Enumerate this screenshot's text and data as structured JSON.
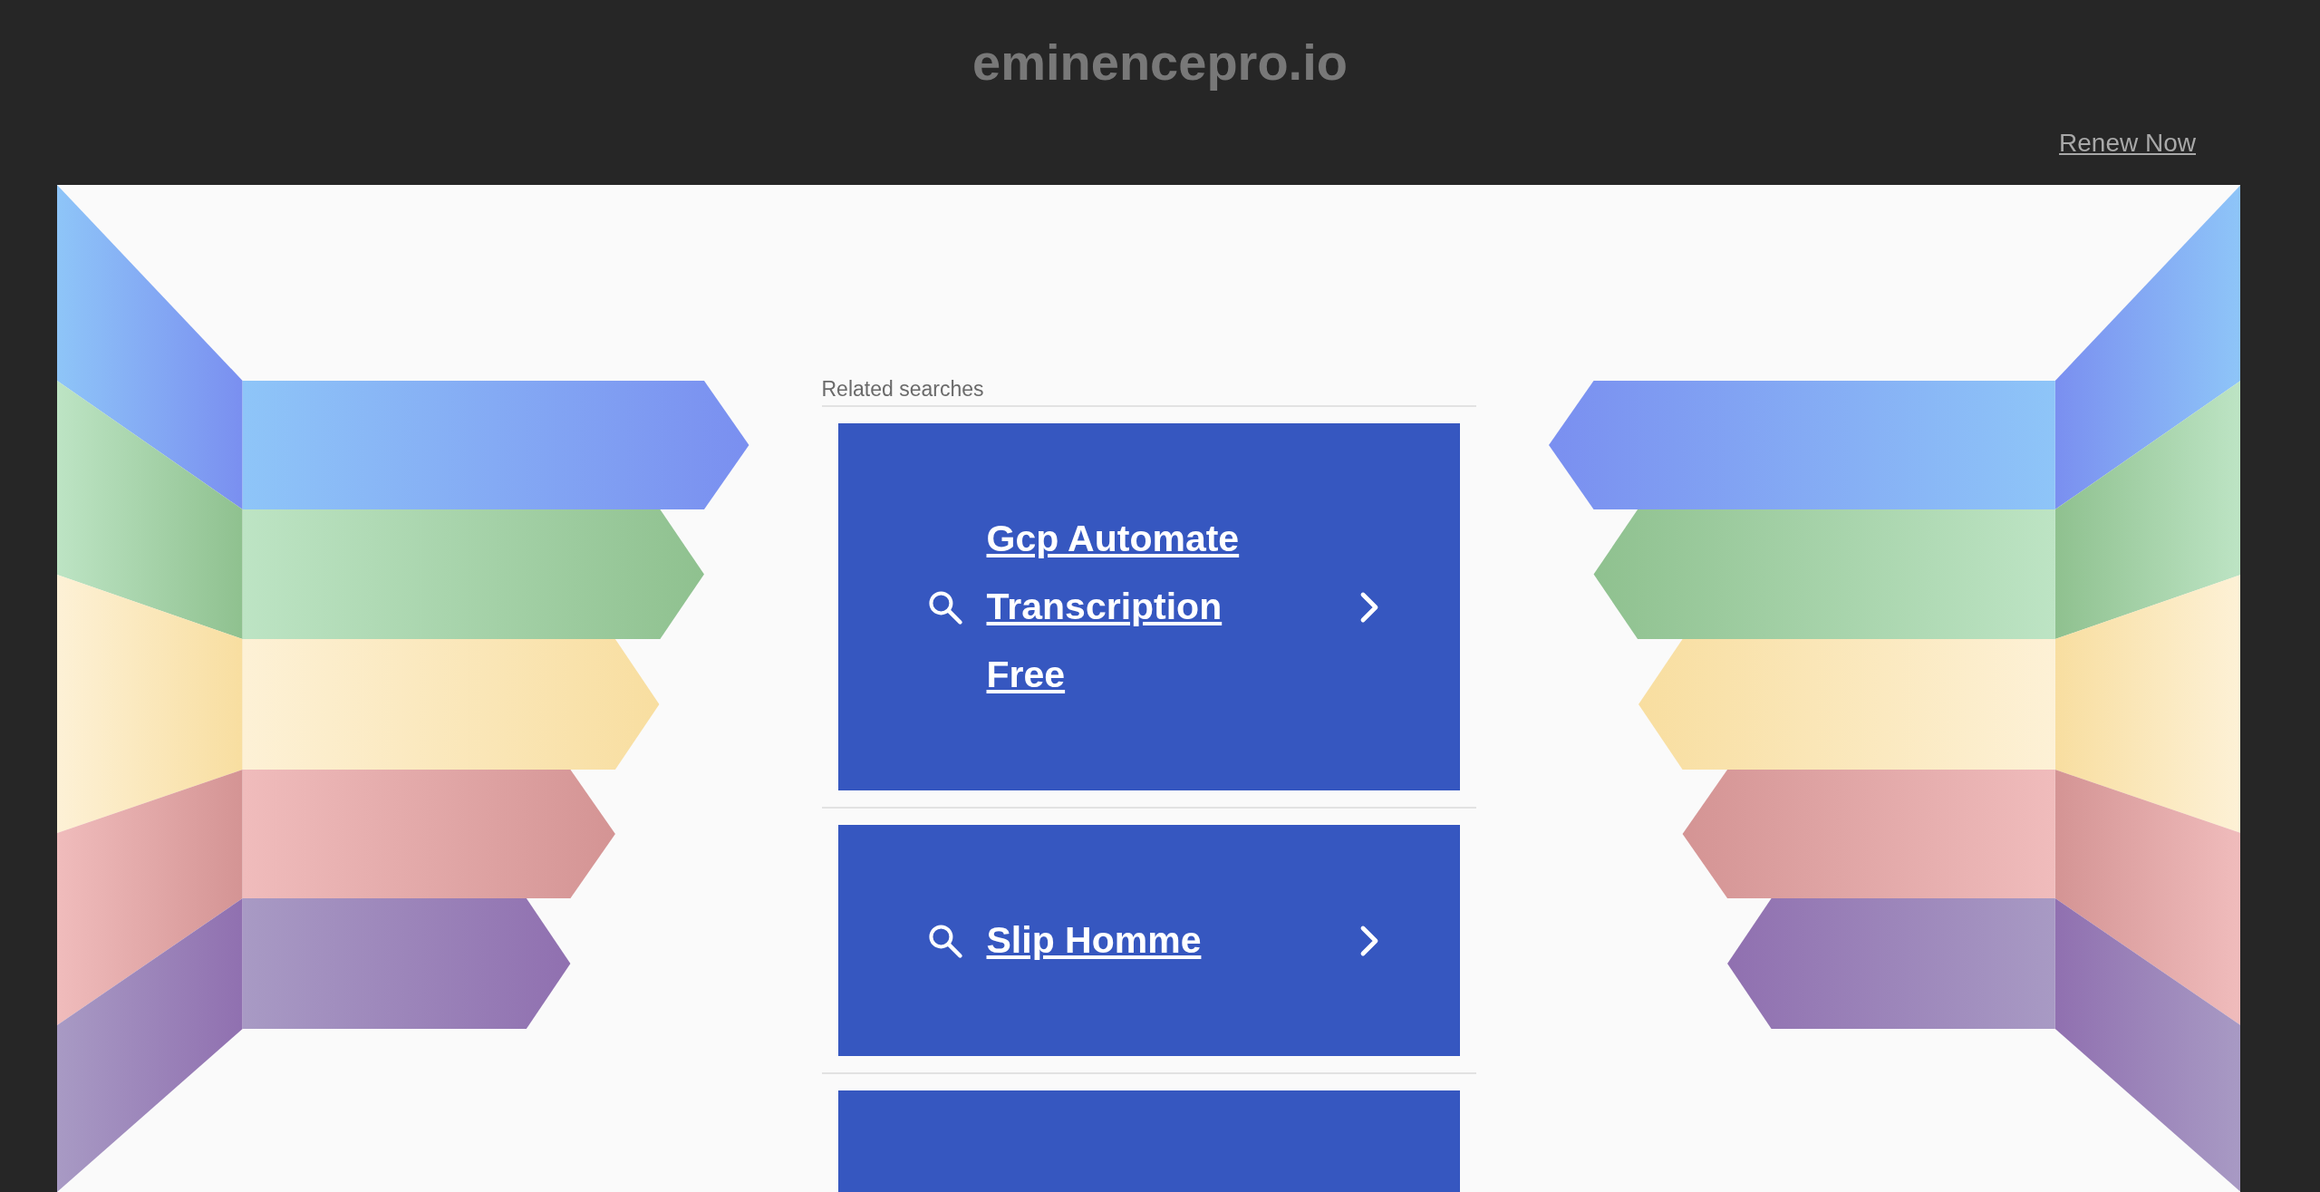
{
  "header": {
    "domain": "eminencepro.io",
    "renew_link": "Renew Now"
  },
  "related": {
    "heading": "Related searches",
    "items": [
      {
        "label": "Gcp Automate Transcription Free"
      },
      {
        "label": "Slip Homme"
      }
    ],
    "more_below": true
  }
}
